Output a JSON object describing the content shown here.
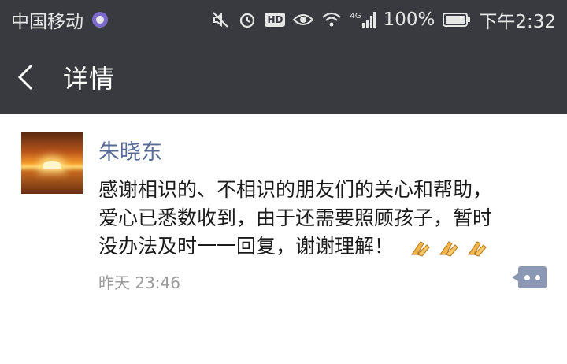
{
  "status_bar": {
    "carrier": "中国移动",
    "network": "4G",
    "battery": "100%",
    "time": "下午2:32"
  },
  "nav": {
    "title": "详情"
  },
  "post": {
    "author": "朱晓东",
    "message_lines": [
      "感谢相识的、不相识的朋友们的关心和帮助，",
      "爱心已悉数收到，由于还需要照顾孩子，暂时",
      "没办法及时一一回复，谢谢理解！"
    ],
    "emojis": [
      "pray-hands-icon",
      "pray-hands-icon",
      "pray-hands-icon"
    ],
    "timestamp": "昨天 23:46"
  },
  "colors": {
    "bar": "#393a3f",
    "author_link": "#576b95",
    "timestamp": "#9a9a9a",
    "comment_button": "#8b98b3"
  }
}
